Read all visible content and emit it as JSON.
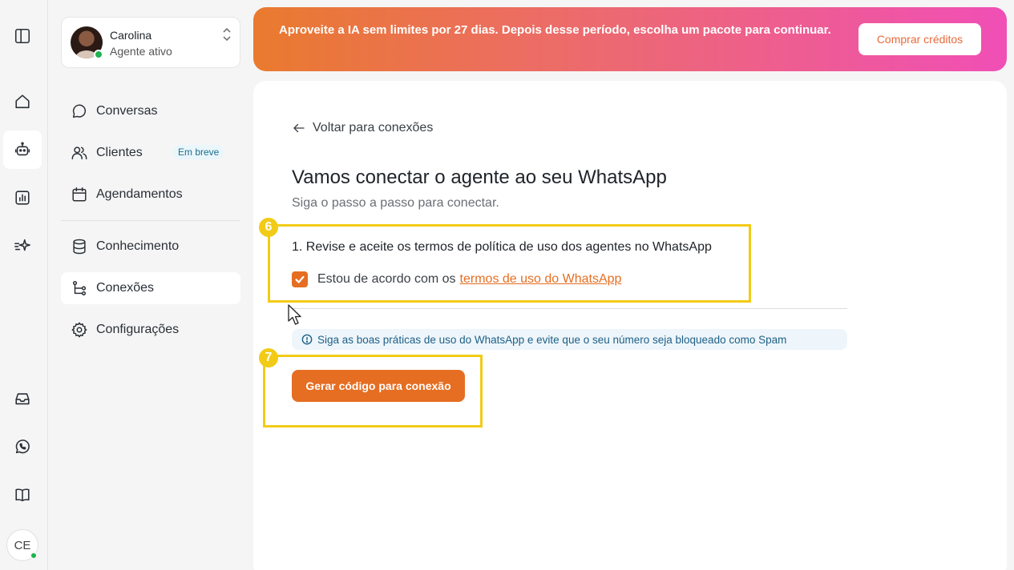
{
  "rail": {
    "icons": [
      "sidebar-toggle-icon",
      "home-icon",
      "robot-icon",
      "chart-icon",
      "sparkles-icon",
      "inbox-icon",
      "whatsapp-icon",
      "book-icon"
    ],
    "user_initials": "CE"
  },
  "user": {
    "name": "Carolina",
    "status": "Agente ativo"
  },
  "nav": {
    "items": [
      {
        "label": "Conversas"
      },
      {
        "label": "Clientes",
        "badge": "Em breve"
      },
      {
        "label": "Agendamentos"
      },
      {
        "label": "Conhecimento"
      },
      {
        "label": "Conexões"
      },
      {
        "label": "Configurações"
      }
    ]
  },
  "banner": {
    "text": "Aproveite a IA sem limites por 27 dias. Depois desse período, escolha um pacote para continuar.",
    "button": "Comprar créditos"
  },
  "main": {
    "back_link": "Voltar para conexões",
    "title": "Vamos conectar o agente ao seu WhatsApp",
    "subtitle": "Siga o passo a passo para conectar.",
    "step1": "1. Revise e aceite os termos de política de uso dos agentes no WhatsApp",
    "agree_prefix": "Estou de acordo com os",
    "agree_link": "termos de uso do WhatsApp",
    "agree_checked": true,
    "tip": "Siga as boas práticas de uso do WhatsApp e evite que o seu número seja bloqueado como Spam",
    "cta": "Gerar código para conexão"
  },
  "annotations": {
    "marker_a": "6",
    "marker_b": "7"
  },
  "colors": {
    "accent": "#e56e22",
    "annotation": "#f2cb17",
    "online": "#1fb350"
  }
}
